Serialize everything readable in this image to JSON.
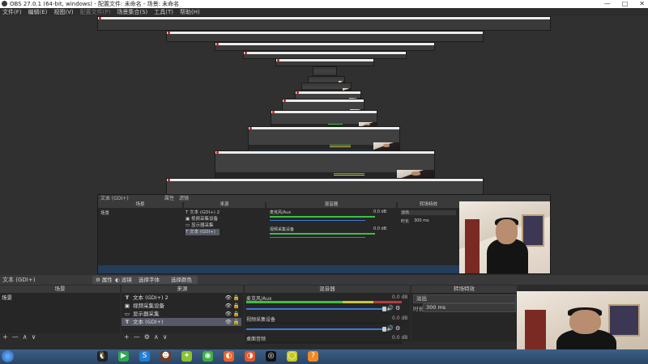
{
  "window": {
    "title": "OBS 27.0.1 (64-bit, windows) - 配置文件: 未命名 - 场景: 未命名",
    "controls": [
      "—",
      "□",
      "✕"
    ]
  },
  "menu": {
    "items": [
      "文件(F)",
      "编辑(E)",
      "视图(V)",
      "配置文件(P)",
      "场景集合(S)",
      "工具(T)",
      "帮助(H)"
    ]
  },
  "nested": {
    "source_name": "文本 (GDI+)",
    "props_label": "属性",
    "filter_label": "滤镜",
    "scenes_header": "场景",
    "sources_header": "来源",
    "mixer_header": "混音器",
    "transitions_header": "转场特效",
    "scene_item": "场景",
    "sources": [
      {
        "icon": "T",
        "name": "文本 (GDI+) 2"
      },
      {
        "icon": "▣",
        "name": "视频采集设备"
      },
      {
        "icon": "▭",
        "name": "显示器采集"
      },
      {
        "icon": "T",
        "name": "文本 (GDI+)"
      }
    ],
    "mixer": [
      {
        "name": "麦克风/Aux",
        "db": "0.0 dB"
      },
      {
        "name": "视频采集设备",
        "db": "0.0 dB"
      }
    ],
    "transition_value": "淡出",
    "duration_label": "时长",
    "duration_value": "300 ms"
  },
  "source_bar": {
    "current_source": "文本 (GDI+)",
    "properties_label": "属性",
    "filters_label": "滤镜",
    "select_font_label": "选择字体",
    "select_color_label": "选择颜色"
  },
  "scenes": {
    "header": "场景",
    "items": [
      "场景"
    ],
    "tools": [
      "+",
      "—",
      "∧",
      "∨"
    ]
  },
  "sources": {
    "header": "来源",
    "items": [
      {
        "icon": "T",
        "name": "文本 (GDI+) 2",
        "visible": "👁",
        "lock": "🔒"
      },
      {
        "icon": "▣",
        "name": "视频采集设备",
        "visible": "👁",
        "lock": "🔒"
      },
      {
        "icon": "▭",
        "name": "显示器采集",
        "visible": "👁",
        "lock": "🔒"
      },
      {
        "icon": "T",
        "name": "文本 (GDI+)",
        "visible": "👁",
        "lock": "🔒"
      }
    ],
    "tools": [
      "+",
      "—",
      "⚙",
      "∧",
      "∨"
    ]
  },
  "mixer": {
    "header": "混音器",
    "channels": [
      {
        "name": "麦克风/Aux",
        "db": "0.0 dB"
      },
      {
        "name": "视频采集设备",
        "db": "0.0 dB"
      },
      {
        "name": "桌面音频",
        "db": "0.0 dB"
      }
    ],
    "volume_icon": "🔊",
    "gear_icon": "⚙"
  },
  "transitions": {
    "header": "转场特效",
    "value": "淡出",
    "duration_label": "时长",
    "duration_value": "300 ms"
  },
  "taskbar": {
    "icons": [
      {
        "name": "qq-icon",
        "glyph": "🐧",
        "color": "#222222"
      },
      {
        "name": "player-icon",
        "glyph": "▶",
        "color": "#2fa84f"
      },
      {
        "name": "sogou-icon",
        "glyph": "S",
        "color": "#1e7fd6"
      },
      {
        "name": "game-icon",
        "glyph": "☻",
        "color": "#6b3e26"
      },
      {
        "name": "arrows-icon",
        "glyph": "✦",
        "color": "#8ac42a"
      },
      {
        "name": "wechat-icon",
        "glyph": "◉",
        "color": "#3cb043"
      },
      {
        "name": "browser-icon",
        "glyph": "◐",
        "color": "#e8642b"
      },
      {
        "name": "firefox-icon",
        "glyph": "◑",
        "color": "#e0582a"
      },
      {
        "name": "obs-icon",
        "glyph": "◎",
        "color": "#111111"
      },
      {
        "name": "circle-icon",
        "glyph": "◯",
        "color": "#c8c820"
      },
      {
        "name": "help-icon",
        "glyph": "?",
        "color": "#f08a24"
      }
    ]
  }
}
